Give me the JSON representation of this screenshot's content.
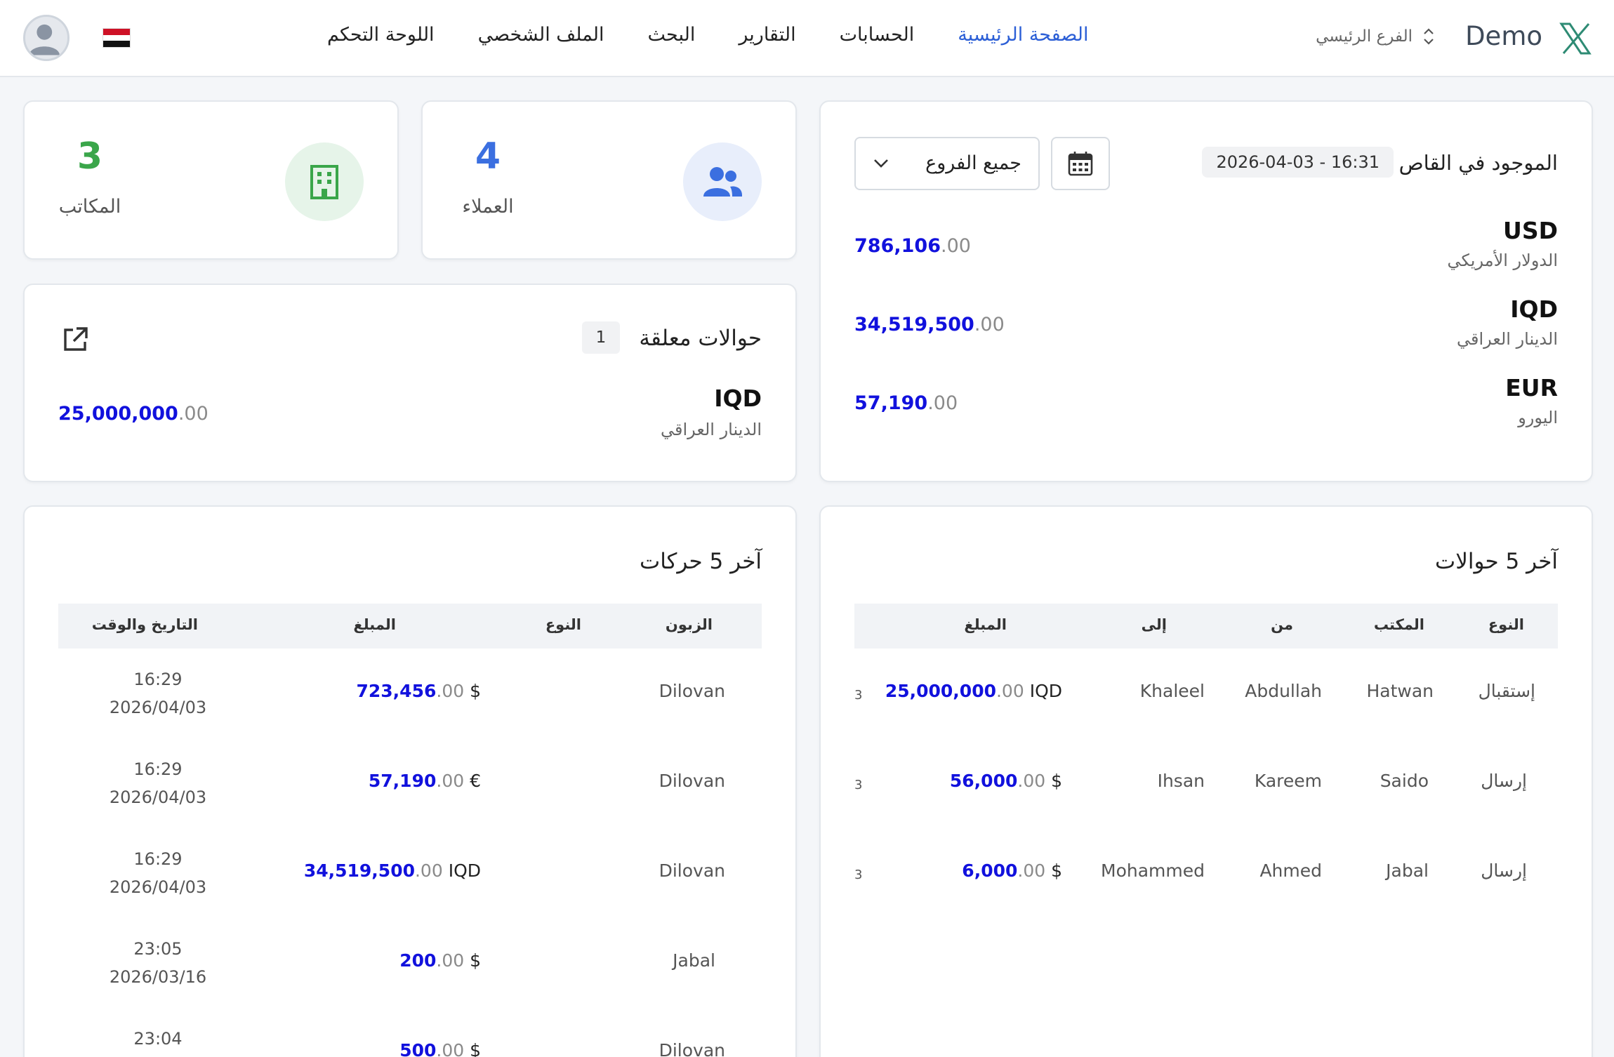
{
  "header": {
    "brand": "Demo",
    "branch": "الفرع الرئيسي",
    "nav": [
      "الصفحة الرئيسية",
      "الحسابات",
      "التقارير",
      "البحث",
      "الملف الشخصي",
      "اللوحة التحكم"
    ]
  },
  "cash": {
    "title": "الموجود في القاص",
    "datetime": "2026-04-03 - 16:31",
    "branch_filter": "جميع الفروع",
    "currencies": [
      {
        "code": "USD",
        "name": "الدولار الأمريكي",
        "amount_main": "786,106",
        "amount_dec": ".00"
      },
      {
        "code": "IQD",
        "name": "الدينار العراقي",
        "amount_main": "34,519,500",
        "amount_dec": ".00"
      },
      {
        "code": "EUR",
        "name": "اليورو",
        "amount_main": "57,190",
        "amount_dec": ".00"
      }
    ]
  },
  "stats": {
    "clients": {
      "value": "4",
      "label": "العملاء"
    },
    "offices": {
      "value": "3",
      "label": "المكاتب"
    }
  },
  "pending": {
    "title": "حوالات معلقة",
    "count": "1",
    "code": "IQD",
    "name": "الدينار العراقي",
    "amount_main": "25,000,000",
    "amount_dec": ".00"
  },
  "moves": {
    "title": "آخر 5 حركات",
    "headers": {
      "customer": "الزبون",
      "type": "النوع",
      "amount": "المبلغ",
      "datetime": "التاريخ والوقت"
    },
    "rows": [
      {
        "customer": "Dilovan",
        "amount_main": "723,456",
        "amount_dec": ".00",
        "symbol": " $",
        "time": "16:29",
        "date": "2026/04/03"
      },
      {
        "customer": "Dilovan",
        "amount_main": "57,190",
        "amount_dec": ".00",
        "symbol": " €",
        "time": "16:29",
        "date": "2026/04/03"
      },
      {
        "customer": "Dilovan",
        "amount_main": "34,519,500",
        "amount_dec": ".00",
        "symbol": " IQD",
        "time": "16:29",
        "date": "2026/04/03"
      },
      {
        "customer": "Jabal",
        "amount_main": "200",
        "amount_dec": ".00",
        "symbol": " $",
        "time": "23:05",
        "date": "2026/03/16"
      },
      {
        "customer": "Dilovan",
        "amount_main": "500",
        "amount_dec": ".00",
        "symbol": " $",
        "time": "23:04",
        "date": ""
      }
    ]
  },
  "transfers": {
    "title": "آخر 5 حوالات",
    "headers": {
      "type": "النوع",
      "office": "المكتب",
      "from": "من",
      "to": "إلى",
      "amount": "المبلغ"
    },
    "rows": [
      {
        "type": "إستقبال",
        "office": "Hatwan",
        "from": "Abdullah",
        "to": "Khaleel",
        "amount_main": "25,000,000",
        "amount_dec": ".00",
        "symbol": " IQD",
        "stub": "3"
      },
      {
        "type": "إرسال",
        "office": "Saido",
        "from": "Kareem",
        "to": "Ihsan",
        "amount_main": "56,000",
        "amount_dec": ".00",
        "symbol": " $",
        "stub": "3"
      },
      {
        "type": "إرسال",
        "office": "Jabal",
        "from": "Ahmed",
        "to": "Mohammed",
        "amount_main": "6,000",
        "amount_dec": ".00",
        "symbol": " $",
        "stub": "3"
      }
    ]
  },
  "colors": {
    "accent": "#2c5fd6",
    "amount": "#1111dd",
    "clients_icon": "#3b6fe0",
    "offices_icon": "#3aa64a",
    "offices_number": "#3aa64a"
  },
  "icons": [
    "x-logo-icon",
    "sort-icon",
    "iraq-flag-icon",
    "avatar-icon",
    "calendar-icon",
    "chevron-down-icon",
    "users-icon",
    "building-icon",
    "external-link-icon"
  ]
}
